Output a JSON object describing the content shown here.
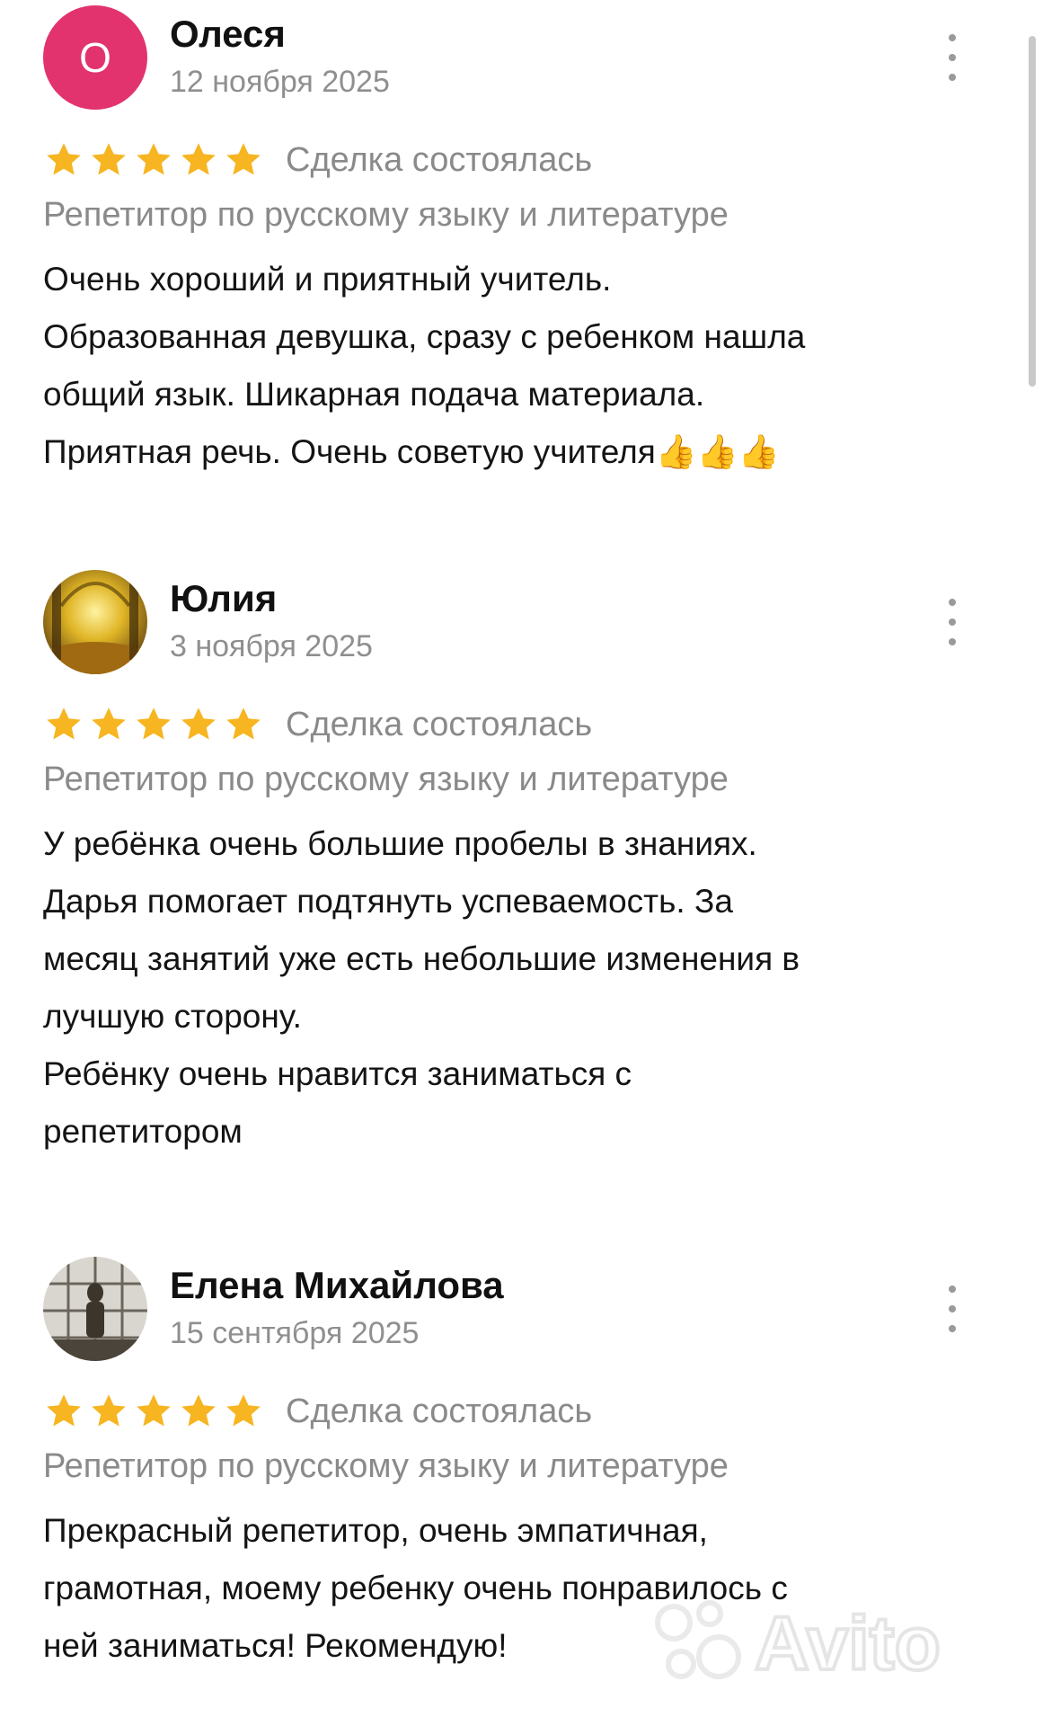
{
  "reviews": [
    {
      "name": "Олеся",
      "date": "12 ноября 2025",
      "avatar": {
        "type": "letter",
        "letter": "О",
        "color": "#e2336f"
      },
      "rating": 5,
      "deal_status": "Сделка состоялась",
      "subject": "Репетитор по русскому языку и литературе",
      "lines": [
        "Очень хороший и приятный учитель.",
        "Образованная девушка, сразу с ребенком нашла",
        "общий язык. Шикарная подача материала.",
        "Приятная речь. Очень советую учителя👍👍👍"
      ]
    },
    {
      "name": "Юлия",
      "date": "3 ноября 2025",
      "avatar": {
        "type": "photo",
        "description_icon": "avatar-photo-icon"
      },
      "rating": 5,
      "deal_status": "Сделка состоялась",
      "subject": "Репетитор по русскому языку и литературе",
      "lines": [
        "У ребёнка очень большие пробелы в знаниях.",
        "Дарья помогает подтянуть успеваемость. За",
        "месяц занятий уже есть небольшие изменения в",
        "лучшую сторону.",
        "Ребёнку очень нравится заниматься с",
        "репетитором"
      ]
    },
    {
      "name": "Елена Михайлова",
      "date": "15 сентября 2025",
      "avatar": {
        "type": "photo",
        "description_icon": "avatar-photo-icon"
      },
      "rating": 5,
      "deal_status": "Сделка состоялась",
      "subject": "Репетитор по русскому языку и литературе",
      "lines": [
        "Прекрасный репетитор, очень эмпатичная,",
        "грамотная, моему ребенку очень понравилось с",
        "ней заниматься! Рекомендую!"
      ]
    }
  ],
  "colors": {
    "star": "#f6b521",
    "secondary_text": "#8a8a8a",
    "accent_avatar": "#e2336f"
  },
  "icons": {
    "star": "star-icon",
    "more": "more-vertical-icon",
    "watermark": "avito-logo"
  },
  "watermark_text": "Avito"
}
